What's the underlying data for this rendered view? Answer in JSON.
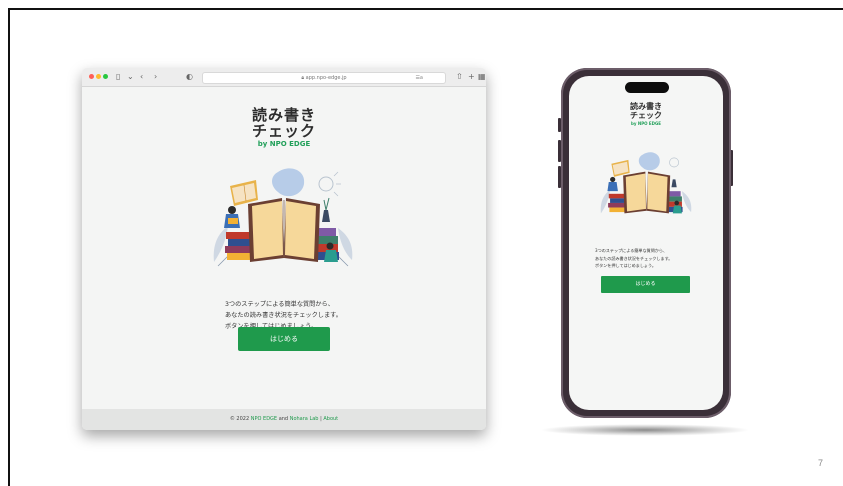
{
  "slide": {
    "page_number": "7"
  },
  "browser": {
    "url": "app.npo-edge.jp",
    "reader_label": "☰a",
    "app_title_line1": "読み書き",
    "app_title_line2": "チェック",
    "by_line": "by NPO EDGE",
    "description_line1": "3つのステップによる簡単な質問から、",
    "description_line2": "あなたの読み書き状況をチェックします。",
    "description_line3": "ボタンを押してはじめましょう。",
    "start_button": "はじめる",
    "footer": {
      "copyright": "© 2022",
      "org_link": "NPO EDGE",
      "and_text": "and",
      "lab_link": "Nohara Lab",
      "separator": "|",
      "about_link": "About"
    }
  },
  "phone": {
    "app_title_line1": "読み書き",
    "app_title_line2": "チェック",
    "by_line": "by NPO EDGE",
    "description_line1": "3つのステップによる簡単な質問から、",
    "description_line2": "あなたの読み書き状況をチェックします。",
    "description_line3": "ボタンを押してはじめましょう。",
    "start_button": "はじめる"
  },
  "colors": {
    "accent": "#1f9a4c",
    "page_bg": "#f4f5f4",
    "phone_frame": "#3a2f38"
  }
}
